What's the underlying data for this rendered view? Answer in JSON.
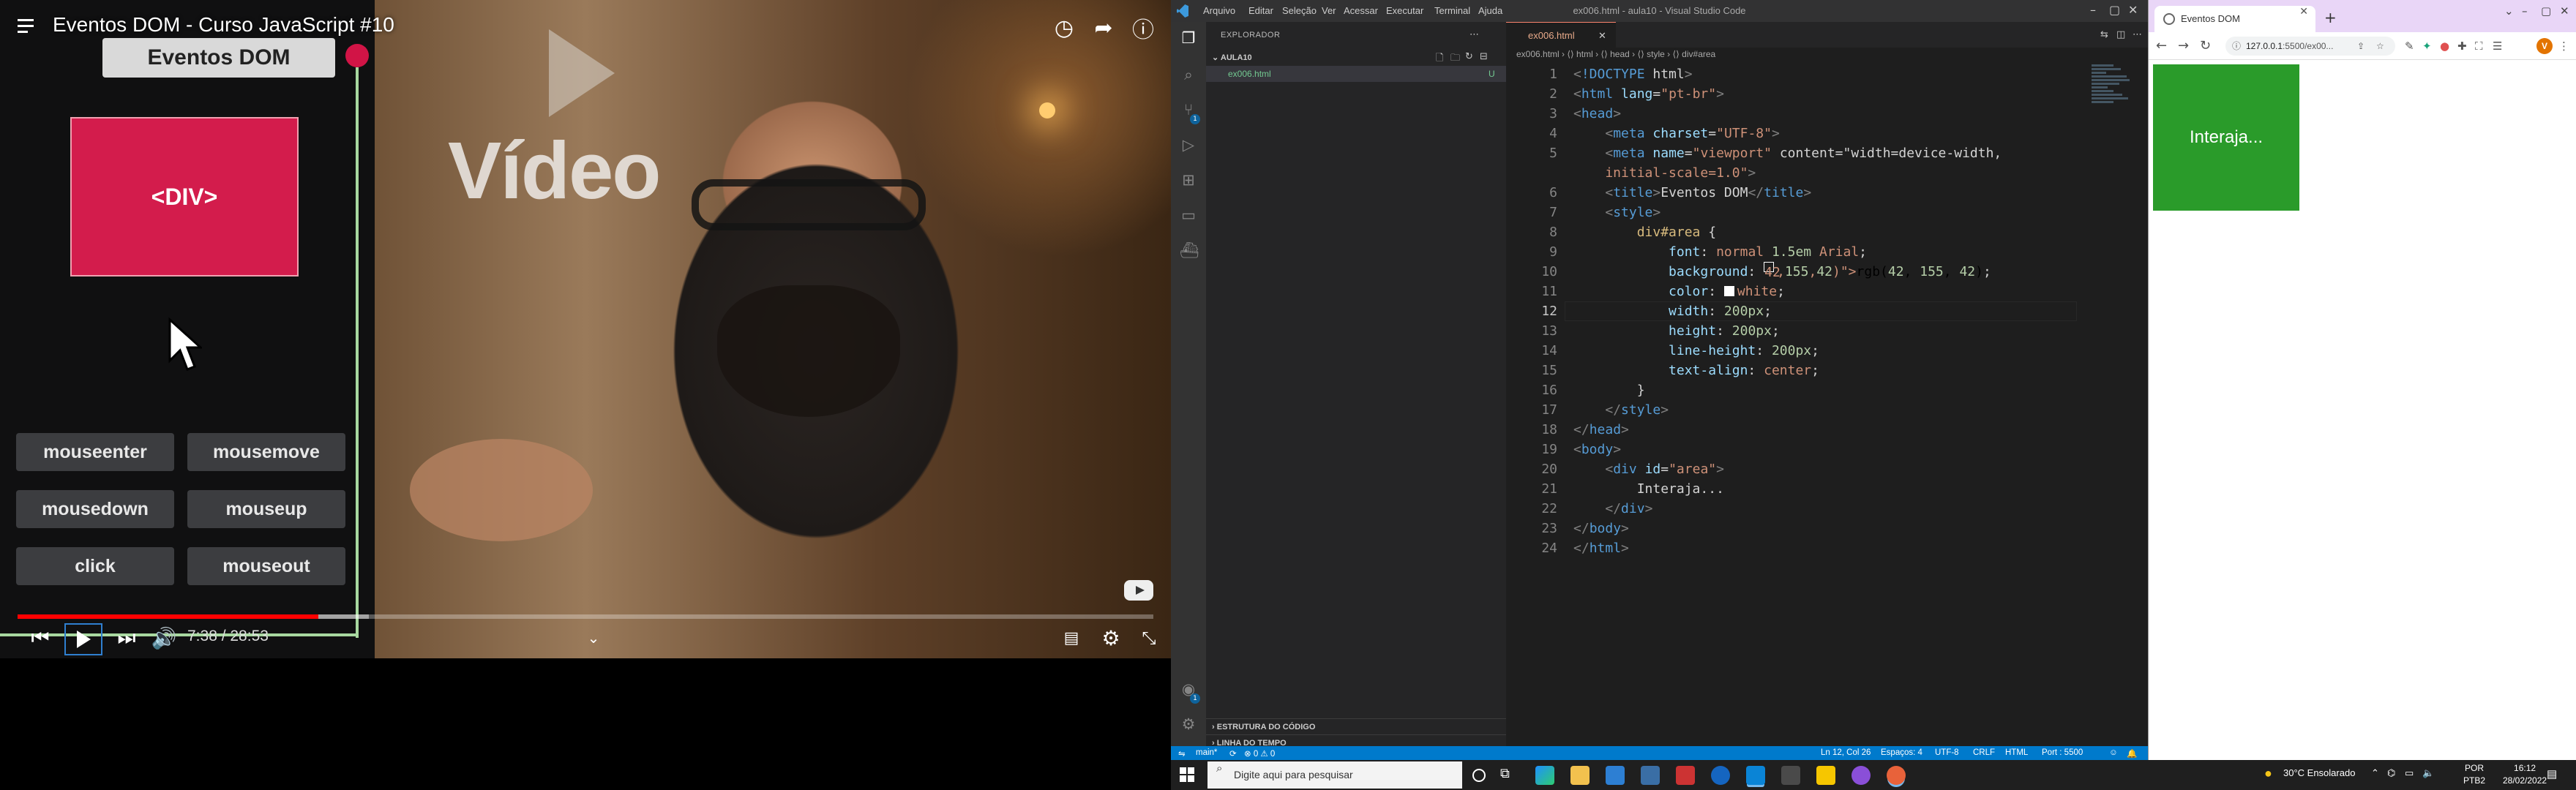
{
  "player": {
    "title": "Eventos DOM - Curso JavaScript #10",
    "demo_title": "Eventos DOM",
    "demo_div_label": "<DIV>",
    "video_text": "Vídeo",
    "event_buttons": [
      "mouseenter",
      "mousemove",
      "mousedown",
      "mouseup",
      "click",
      "mouseout"
    ],
    "time": "7:38 / 28:53",
    "progress": 0.2645
  },
  "vscode": {
    "menu": [
      "Arquivo",
      "Editar",
      "Seleção",
      "Ver",
      "Acessar",
      "Executar",
      "Terminal",
      "Ajuda"
    ],
    "window_title": "ex006.html - aula10 - Visual Studio Code",
    "explorer_title": "EXPLORADOR",
    "folder": "AULA10",
    "file": "ex006.html",
    "file_status": "U",
    "outline": "ESTRUTURA DO CÓDIGO",
    "timeline": "LINHA DO TEMPO",
    "tab": "ex006.html",
    "breadcrumb": "ex006.html › ⟨⟩ html › ⟨⟩ head › ⟨⟩ style › ⟨⟩ div#area",
    "code_lines": [
      "<!DOCTYPE html>",
      "<html lang=\"pt-br\">",
      "<head>",
      "    <meta charset=\"UTF-8\">",
      "    <meta name=\"viewport\" content=\"width=device-width,",
      "    <title>Eventos DOM</title>",
      "    <style>",
      "        div#area {",
      "            font: normal 1.5em Arial;",
      "            background: rgb(42, 155, 42);",
      "            color: white;",
      "            width: 200px;",
      "            height: 200px;",
      "            line-height: 200px;",
      "            text-align: center;",
      "        }",
      "    </style>",
      "</head>",
      "<body>",
      "    <div id=\"area\">",
      "        Interaja...",
      "    </div>",
      "</body>",
      "</html>"
    ],
    "wrap_line": "    initial-scale=1.0\">",
    "active_line": 12,
    "status": {
      "branch": "main*",
      "errors": "⊗ 0 ⚠ 0",
      "position": "Ln 12, Col 26",
      "spaces": "Espaços: 4",
      "encoding": "UTF-8",
      "eol": "CRLF",
      "language": "HTML",
      "port": "Port : 5500"
    }
  },
  "chrome": {
    "tab_title": "Eventos DOM",
    "url_host": "127.0.0.1",
    "url_rest": ":5500/ex00...",
    "profile": "V",
    "area_text": "Interaja...",
    "area_color": "#2a9b2a"
  },
  "taskbar": {
    "search_placeholder": "Digite aqui para pesquisar",
    "weather": "30°C  Ensolarado",
    "lang": "POR",
    "layout": "PTB2",
    "time": "16:12",
    "date": "28/02/2022"
  }
}
